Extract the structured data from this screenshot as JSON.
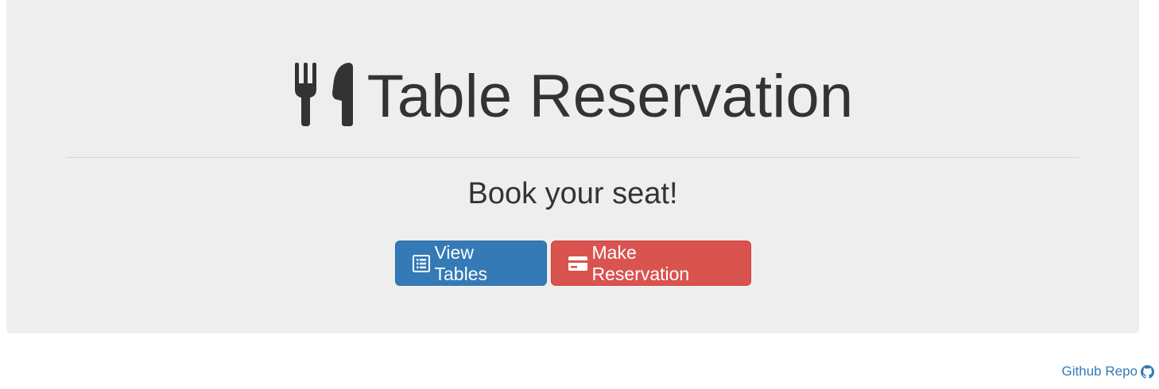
{
  "header": {
    "title": "Table Reservation",
    "title_icon": "cutlery-icon",
    "subtitle": "Book your seat!"
  },
  "actions": {
    "view_tables": {
      "label": "View Tables",
      "icon": "list-alt-icon",
      "color": "#337ab7"
    },
    "make_reservation": {
      "label": "Make Reservation",
      "icon": "credit-card-icon",
      "color": "#d9534f"
    }
  },
  "footer": {
    "repo_link_label": "Github Repo",
    "repo_icon": "github-icon",
    "link_color": "#337ab7"
  },
  "colors": {
    "jumbotron_bg": "#eeeeee",
    "text": "#333333"
  }
}
